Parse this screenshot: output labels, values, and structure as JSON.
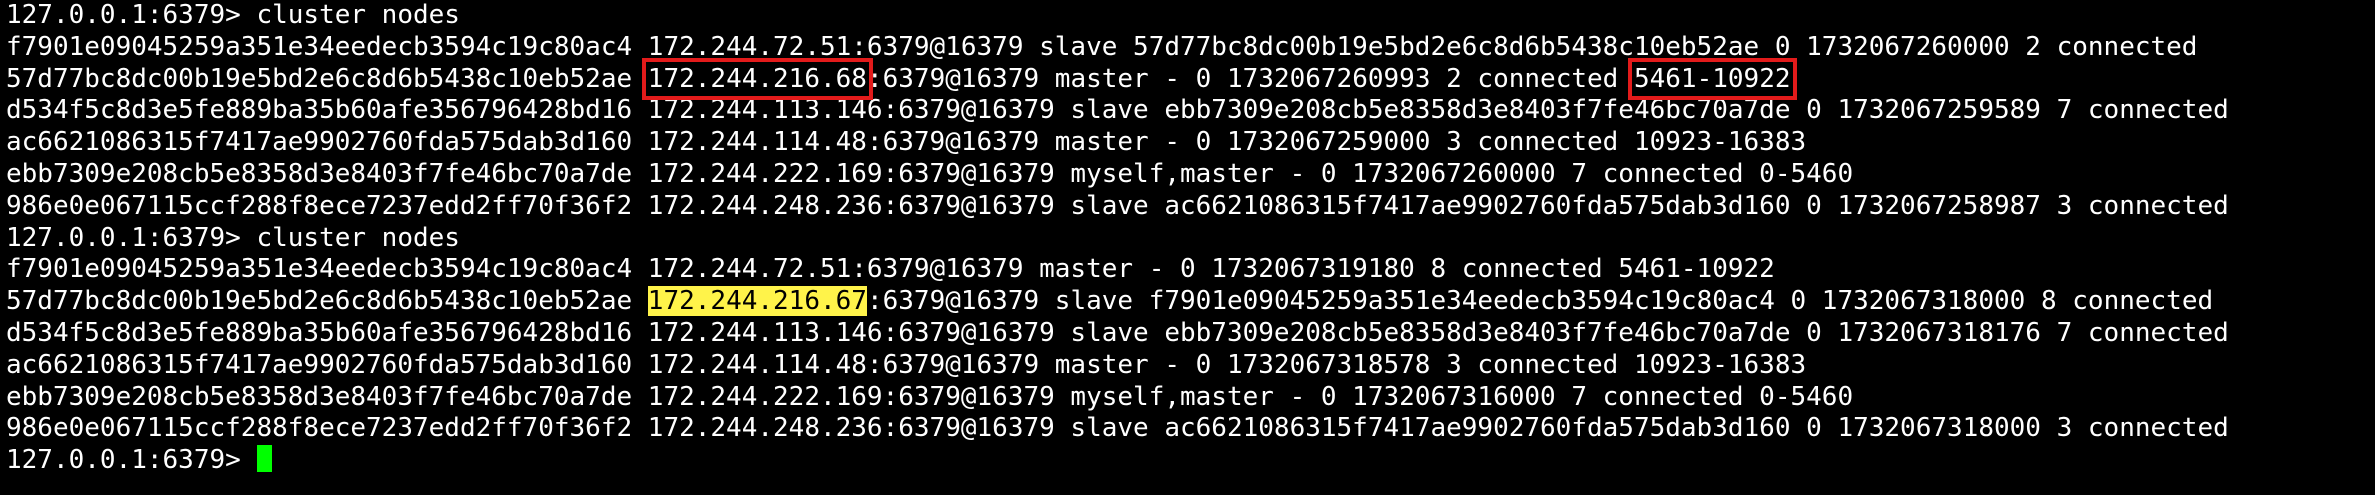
{
  "colors": {
    "background": "#000000",
    "text": "#ffffff",
    "red_box": "#e31b1b",
    "yellow_highlight": "#fff34a",
    "cursor": "#00ff00"
  },
  "terminal": {
    "lines": [
      {
        "kind": "prompt",
        "segments": [
          {
            "text": "127.0.0.1:6379> cluster nodes"
          }
        ]
      },
      {
        "kind": "output",
        "segments": [
          {
            "text": "f7901e09045259a351e34eedecb3594c19c80ac4 172.244.72.51:6379@16379 slave 57d77bc8dc00b19e5bd2e6c8d6b5438c10eb52ae 0 1732067260000 2 connected"
          }
        ]
      },
      {
        "kind": "output",
        "segments": [
          {
            "text": "57d77bc8dc00b19e5bd2e6c8d6b5438c10eb52ae "
          },
          {
            "text": "172.244.216.68",
            "style": "red-box"
          },
          {
            "text": ":6379@16379 master - 0 1732067260993 2 connected "
          },
          {
            "text": "5461-10922",
            "style": "red-box"
          }
        ]
      },
      {
        "kind": "output",
        "segments": [
          {
            "text": "d534f5c8d3e5fe889ba35b60afe356796428bd16 172.244.113.146:6379@16379 slave ebb7309e208cb5e8358d3e8403f7fe46bc70a7de 0 1732067259589 7 connected"
          }
        ]
      },
      {
        "kind": "output",
        "segments": [
          {
            "text": "ac6621086315f7417ae9902760fda575dab3d160 172.244.114.48:6379@16379 master - 0 1732067259000 3 connected 10923-16383"
          }
        ]
      },
      {
        "kind": "output",
        "segments": [
          {
            "text": "ebb7309e208cb5e8358d3e8403f7fe46bc70a7de 172.244.222.169:6379@16379 myself,master - 0 1732067260000 7 connected 0-5460"
          }
        ]
      },
      {
        "kind": "output",
        "segments": [
          {
            "text": "986e0e067115ccf288f8ece7237edd2ff70f36f2 172.244.248.236:6379@16379 slave ac6621086315f7417ae9902760fda575dab3d160 0 1732067258987 3 connected"
          }
        ]
      },
      {
        "kind": "prompt",
        "segments": [
          {
            "text": "127.0.0.1:6379> cluster nodes"
          }
        ]
      },
      {
        "kind": "output",
        "segments": [
          {
            "text": "f7901e09045259a351e34eedecb3594c19c80ac4 172.244.72.51:6379@16379 master - 0 1732067319180 8 connected 5461-10922"
          }
        ]
      },
      {
        "kind": "output",
        "segments": [
          {
            "text": "57d77bc8dc00b19e5bd2e6c8d6b5438c10eb52ae "
          },
          {
            "text": "172.244.216.67",
            "style": "yellow"
          },
          {
            "text": ":6379@16379 slave f7901e09045259a351e34eedecb3594c19c80ac4 0 1732067318000 8 connected"
          }
        ]
      },
      {
        "kind": "output",
        "segments": [
          {
            "text": "d534f5c8d3e5fe889ba35b60afe356796428bd16 172.244.113.146:6379@16379 slave ebb7309e208cb5e8358d3e8403f7fe46bc70a7de 0 1732067318176 7 connected"
          }
        ]
      },
      {
        "kind": "output",
        "segments": [
          {
            "text": "ac6621086315f7417ae9902760fda575dab3d160 172.244.114.48:6379@16379 master - 0 1732067318578 3 connected 10923-16383"
          }
        ]
      },
      {
        "kind": "output",
        "segments": [
          {
            "text": "ebb7309e208cb5e8358d3e8403f7fe46bc70a7de 172.244.222.169:6379@16379 myself,master - 0 1732067316000 7 connected 0-5460"
          }
        ]
      },
      {
        "kind": "output",
        "segments": [
          {
            "text": "986e0e067115ccf288f8ece7237edd2ff70f36f2 172.244.248.236:6379@16379 slave ac6621086315f7417ae9902760fda575dab3d160 0 1732067318000 3 connected"
          }
        ]
      },
      {
        "kind": "input",
        "segments": [
          {
            "text": "127.0.0.1:6379> "
          }
        ],
        "cursor": true
      }
    ]
  }
}
